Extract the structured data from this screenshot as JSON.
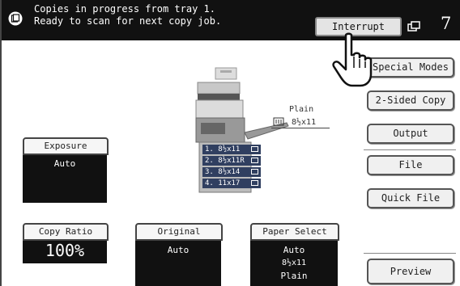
{
  "header": {
    "status_line1": "Copies in progress from tray 1.",
    "status_line2": "Ready to scan for next copy job.",
    "interrupt_label": "Interrupt",
    "job_count": "7"
  },
  "right_menu": {
    "special_modes": "Special Modes",
    "two_sided_copy": "2-Sided Copy",
    "output": "Output",
    "file": "File",
    "quick_file": "Quick File",
    "preview": "Preview"
  },
  "exposure": {
    "label": "Exposure",
    "value": "Auto"
  },
  "copy_ratio": {
    "label": "Copy Ratio",
    "value": "100%"
  },
  "original": {
    "label": "Original",
    "value": "Auto"
  },
  "paper_select": {
    "label": "Paper Select",
    "value_line1": "Auto",
    "value_line2": "8½x11",
    "value_line3": "Plain"
  },
  "machine": {
    "paper_type": "Plain",
    "paper_size": "8½x11",
    "trays": [
      "1. 8½x11",
      "2. 8½x11R",
      "3. 8½x14",
      "4. 11x17"
    ]
  },
  "colors": {
    "header_bg": "#111111",
    "tray_bg": "#303f60",
    "box_bg": "#111111"
  }
}
